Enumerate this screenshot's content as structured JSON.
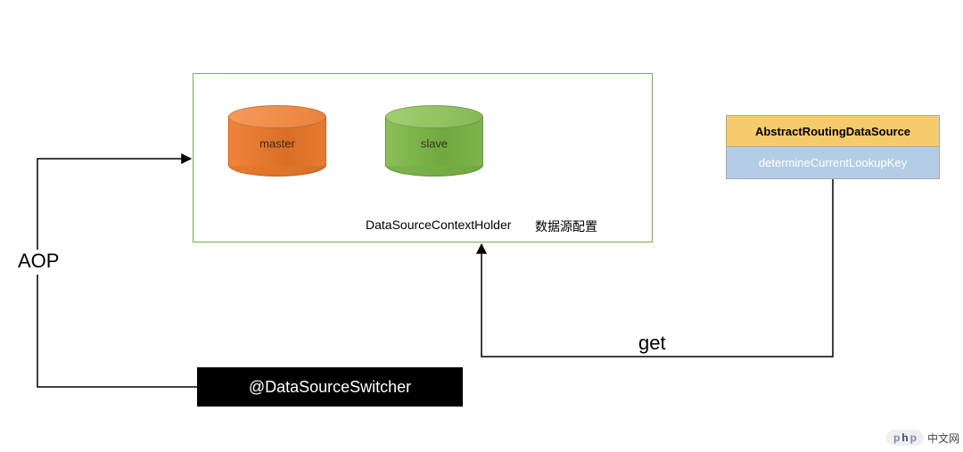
{
  "chart_data": {
    "type": "diagram",
    "nodes": [
      {
        "id": "aop",
        "label": "AOP"
      },
      {
        "id": "switcher",
        "label": "@DataSourceSwitcher"
      },
      {
        "id": "context_holder",
        "label": "DataSourceContextHolder",
        "sublabel": "数据源配置",
        "children": [
          {
            "id": "master",
            "label": "master",
            "shape": "cylinder",
            "color": "#e77a2e"
          },
          {
            "id": "slave",
            "label": "slave",
            "shape": "cylinder",
            "color": "#7db44c"
          }
        ]
      },
      {
        "id": "abstract_routing",
        "label": "AbstractRoutingDataSource"
      },
      {
        "id": "determine_key",
        "label": "determineCurrentLookupKey"
      }
    ],
    "edges": [
      {
        "from": "aop",
        "to": "context_holder",
        "direction": "to"
      },
      {
        "from": "aop",
        "to": "switcher",
        "direction": "none"
      },
      {
        "from": "determine_key",
        "to": "context_holder",
        "label": "get",
        "direction": "to"
      }
    ]
  },
  "labels": {
    "aop": "AOP",
    "get": "get",
    "context_holder": "DataSourceContextHolder",
    "context_holder_cfg": "数据源配置",
    "master": "master",
    "slave": "slave",
    "abstract_routing": "AbstractRoutingDataSource",
    "determine_key": "determineCurrentLookupKey",
    "switcher": "@DataSourceSwitcher"
  },
  "watermark": {
    "logo_p": "p",
    "logo_h": "h",
    "logo_p2": "p",
    "text": "中文网"
  }
}
